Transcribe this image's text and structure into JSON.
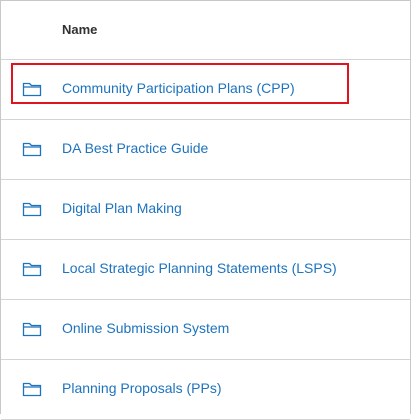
{
  "list": {
    "column_header": "Name",
    "rows": [
      {
        "label": "Community Participation Plans (CPP)",
        "icon": "folder-icon"
      },
      {
        "label": "DA Best Practice Guide",
        "icon": "folder-icon"
      },
      {
        "label": "Digital Plan Making",
        "icon": "folder-icon"
      },
      {
        "label": "Local Strategic Planning Statements (LSPS)",
        "icon": "folder-icon"
      },
      {
        "label": "Online Submission System",
        "icon": "folder-icon"
      },
      {
        "label": "Planning Proposals (PPs)",
        "icon": "folder-icon"
      }
    ]
  },
  "colors": {
    "link": "#1e73be",
    "highlight": "#e0141e",
    "divider": "#d4d4d4"
  }
}
